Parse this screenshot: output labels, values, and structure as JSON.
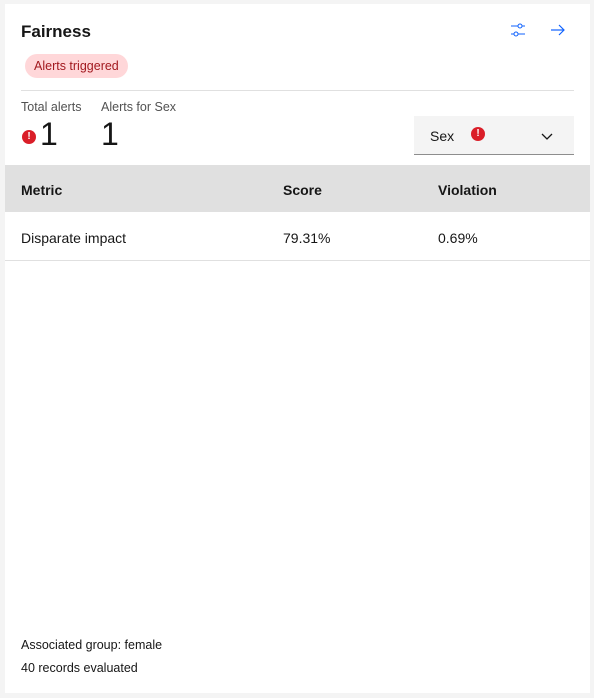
{
  "card": {
    "title": "Fairness",
    "tag": "Alerts triggered",
    "icons": {
      "settings": "settings-adjust-icon",
      "navigate": "arrow-right-icon"
    }
  },
  "stats": {
    "total_label": "Total alerts",
    "total_value": "1",
    "sex_label": "Alerts for Sex",
    "sex_value": "1"
  },
  "dropdown": {
    "selected": "Sex",
    "has_alert": true
  },
  "table": {
    "columns": [
      "Metric",
      "Score",
      "Violation"
    ],
    "rows": [
      [
        "Disparate impact",
        "79.31%",
        "0.69%"
      ]
    ]
  },
  "footer": {
    "group": "Associated group: female",
    "records": "40 records evaluated"
  },
  "colors": {
    "accent": "#0f62fe",
    "error": "#da1e28",
    "tag_bg": "#ffd7d9",
    "tag_text": "#a2191f"
  }
}
